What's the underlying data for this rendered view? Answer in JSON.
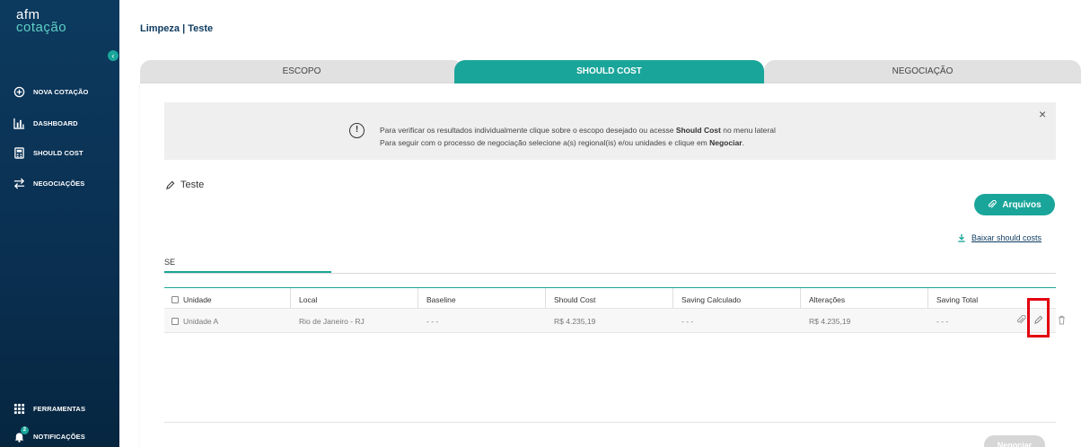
{
  "sidebar": {
    "logo_line1": "afm",
    "logo_line2": "cotação",
    "collapse_icon": "‹",
    "items": [
      {
        "label": "NOVA COTAÇÃO",
        "icon": "plus-circle-icon"
      },
      {
        "label": "DASHBOARD",
        "icon": "bar-chart-icon"
      },
      {
        "label": "SHOULD COST",
        "icon": "calculator-icon"
      },
      {
        "label": "NEGOCIAÇÕES",
        "icon": "swap-arrows-icon"
      }
    ],
    "bottom_items": [
      {
        "label": "FERRAMENTAS",
        "icon": "grid-icon"
      },
      {
        "label": "NOTIFICAÇÕES",
        "icon": "bell-icon",
        "badge": "2"
      }
    ]
  },
  "breadcrumb": "Limpeza | Teste",
  "tabs": [
    {
      "label": "ESCOPO",
      "active": false
    },
    {
      "label": "SHOULD COST",
      "active": true
    },
    {
      "label": "NEGOCIAÇÃO",
      "active": false
    }
  ],
  "info": {
    "line1_prefix": "Para verificar os resultados individualmente clique sobre o escopo desejado ou acesse ",
    "line1_bold": "Should Cost",
    "line1_suffix": " no menu lateral",
    "line2_prefix": "Para seguir com o processo de negociação selecione a(s) regional(is) e/ou unidades e clique em ",
    "line2_bold": "Negociar",
    "line2_suffix": ".",
    "close": "×"
  },
  "scope_name": "Teste",
  "arquivos_label": "Arquivos",
  "baixar_label": "Baixar should costs",
  "region_tab": "SE",
  "table": {
    "headers": [
      "Unidade",
      "Local",
      "Baseline",
      "Should Cost",
      "Saving Calculado",
      "Alterações",
      "Saving Total"
    ],
    "rows": [
      [
        "Unidade A",
        "Rio de Janeiro - RJ",
        "- - -",
        "R$ 4.235,19",
        "- - -",
        "R$ 4.235,19",
        "- - -"
      ]
    ]
  },
  "negociar_label": "Negociar",
  "colors": {
    "sidebar": "#0c3a5f",
    "accent": "#1aa59a",
    "highlight": "#e3000f"
  }
}
